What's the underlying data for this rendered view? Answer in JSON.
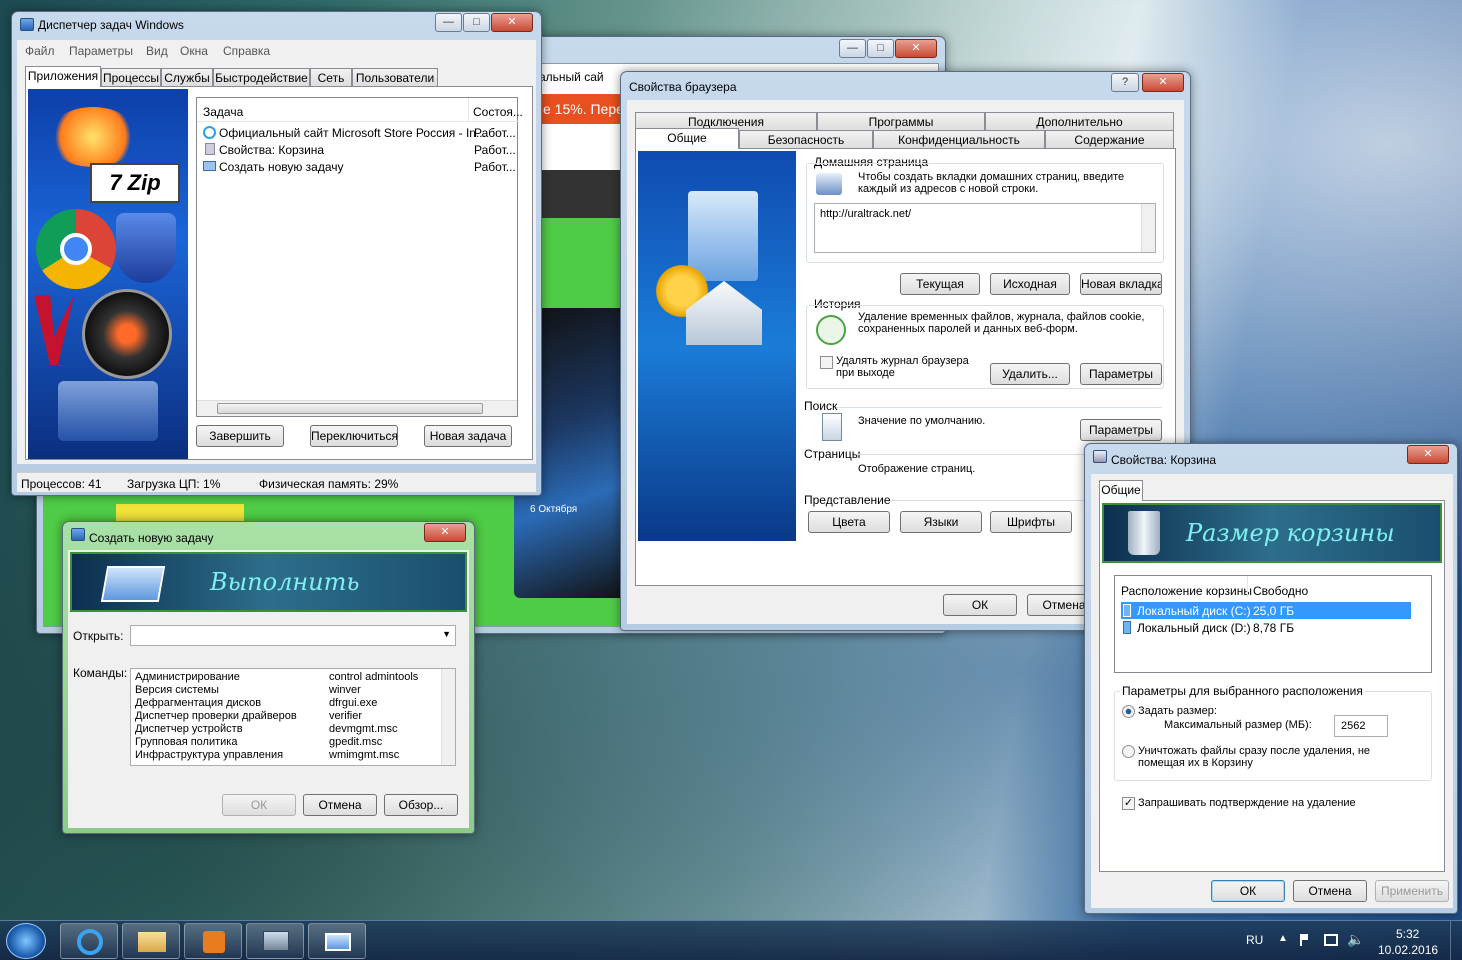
{
  "task_manager": {
    "title": "Диспетчер задач Windows",
    "menu": [
      "Файл",
      "Параметры",
      "Вид",
      "Окна",
      "Справка"
    ],
    "tabs": [
      "Приложения",
      "Процессы",
      "Службы",
      "Быстродействие",
      "Сеть",
      "Пользователи"
    ],
    "columns": [
      "Задача",
      "Состоя..."
    ],
    "rows": [
      {
        "task": "Официальный сайт Microsoft Store Россия - In...",
        "status": "Работ..."
      },
      {
        "task": "Свойства: Корзина",
        "status": "Работ..."
      },
      {
        "task": "Создать новую задачу",
        "status": "Работ..."
      }
    ],
    "buttons": {
      "end": "Завершить",
      "switch": "Переключиться",
      "new": "Новая задача"
    },
    "status": {
      "processes": "Процессов: 41",
      "cpu": "Загрузка ЦП: 1%",
      "memory": "Физическая память: 29%"
    },
    "logo_text": "7 Zip"
  },
  "browser_window": {
    "banner_text": "альный сай",
    "promo": "е 15%. Пере",
    "device_text": "6 Октября"
  },
  "inet_options": {
    "title": "Свойства браузера",
    "help": "?",
    "tabs_back": [
      "Подключения",
      "Программы",
      "Дополнительно"
    ],
    "tabs_front": [
      "Общие",
      "Безопасность",
      "Конфиденциальность",
      "Содержание"
    ],
    "home": {
      "title": "Домашняя страница",
      "desc": "Чтобы создать вкладки домашних страниц, введите каждый из адресов с новой строки.",
      "url": "http://uraltrack.net/",
      "btn_current": "Текущая",
      "btn_default": "Исходная",
      "btn_newtab": "Новая вкладка"
    },
    "history": {
      "title": "История",
      "desc": "Удаление временных файлов, журнала, файлов cookie, сохраненных паролей и данных веб-форм.",
      "check": "Удалять журнал браузера при выходе",
      "btn_delete": "Удалить...",
      "btn_params": "Параметры"
    },
    "search": {
      "title": "Поиск",
      "desc": "Значение по умолчанию.",
      "btn_params": "Параметры"
    },
    "pages": {
      "title": "Страницы",
      "desc": "Отображение страниц."
    },
    "view": {
      "title": "Представление",
      "btn_colors": "Цвета",
      "btn_langs": "Языки",
      "btn_fonts": "Шрифты"
    },
    "ok": "ОК",
    "cancel": "Отмена"
  },
  "run": {
    "title": "Создать новую задачу",
    "banner": "Выполнить",
    "open_label": "Открыть:",
    "commands_label": "Команды:",
    "commands": [
      [
        "Администрирование",
        "control admintools"
      ],
      [
        "Версия системы",
        "winver"
      ],
      [
        "Дефрагментация дисков",
        "dfrgui.exe"
      ],
      [
        "Диспетчер проверки драйверов",
        "verifier"
      ],
      [
        "Диспетчер устройств",
        "devmgmt.msc"
      ],
      [
        "Групповая политика",
        "gpedit.msc"
      ],
      [
        "Инфраструктура управления",
        "wmimgmt.msc"
      ]
    ],
    "ok": "ОК",
    "cancel": "Отмена",
    "browse": "Обзор..."
  },
  "recycle": {
    "title": "Свойства: Корзина",
    "tab": "Общие",
    "banner": "Размер корзины",
    "columns": [
      "Расположение корзины",
      "Свободно"
    ],
    "rows": [
      {
        "loc": "Локальный диск (C:)",
        "free": "25,0 ГБ"
      },
      {
        "loc": "Локальный диск (D:)",
        "free": "8,78 ГБ"
      }
    ],
    "group": "Параметры для выбранного расположения",
    "radio_size": "Задать размер:",
    "max_label": "Максимальный размер (МБ):",
    "max_value": "2562",
    "radio_delete": "Уничтожать файлы сразу после удаления, не помещая их в Корзину",
    "confirm": "Запрашивать подтверждение на удаление",
    "ok": "ОК",
    "cancel": "Отмена",
    "apply": "Применить"
  },
  "taskbar": {
    "lang": "RU",
    "time": "5:32",
    "date": "10.02.2016"
  }
}
